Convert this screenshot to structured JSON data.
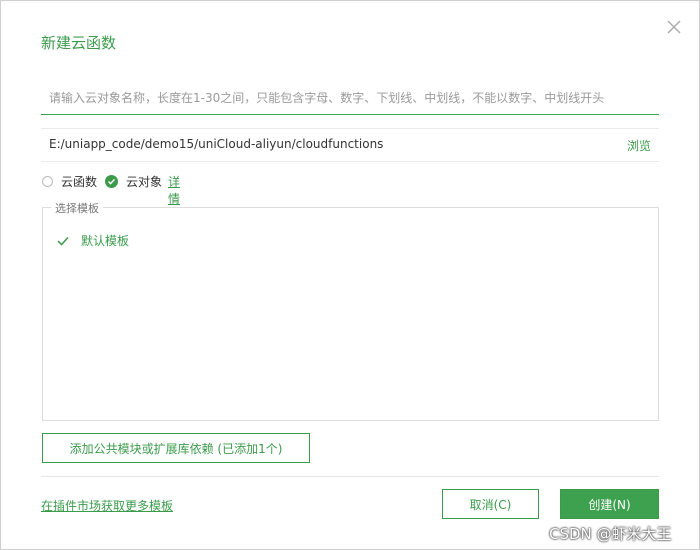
{
  "dialog": {
    "title": "新建云函数",
    "name_input": {
      "value": "",
      "placeholder": "请输入云对象名称，长度在1-30之间，只能包含字母、数字、下划线、中划线，不能以数字、中划线开头"
    },
    "path": {
      "value": "E:/uniapp_code/demo15/uniCloud-aliyun/cloudfunctions",
      "browse_label": "浏览"
    },
    "type_options": [
      {
        "label": "云函数",
        "selected": false
      },
      {
        "label": "云对象",
        "selected": true
      }
    ],
    "detail_link": "详情",
    "template_section": {
      "legend": "选择模板",
      "items": [
        {
          "label": "默认模板",
          "selected": true
        }
      ]
    },
    "module_button": "添加公共模块或扩展库依赖 (已添加1个)",
    "market_link": "在插件市场获取更多模板",
    "cancel_button": "取消(C)",
    "create_button": "创建(N)"
  },
  "watermark": "CSDN @虾米大王",
  "colors": {
    "accent": "#3b9b4b",
    "primary_button_bg": "#3ea14f",
    "border": "#dcdcdc"
  },
  "icons": {
    "close": "close-icon",
    "check": "check-icon",
    "radio_checked": "radio-checked-icon"
  }
}
